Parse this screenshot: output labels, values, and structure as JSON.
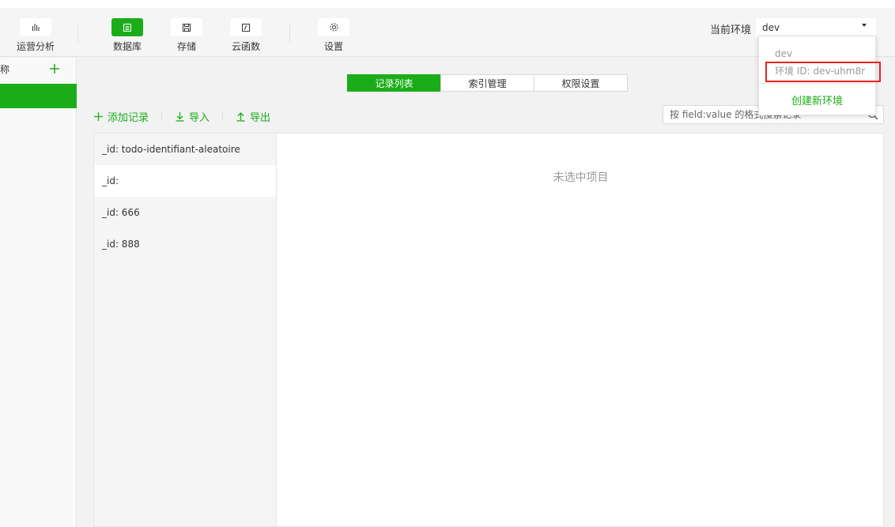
{
  "toolbar": {
    "items": [
      {
        "label": "运营分析",
        "icon": "bar-chart-icon"
      },
      {
        "label": "数据库",
        "icon": "database-icon",
        "active": true
      },
      {
        "label": "存储",
        "icon": "storage-icon"
      },
      {
        "label": "云函数",
        "icon": "cloud-function-icon"
      },
      {
        "label": "设置",
        "icon": "gear-icon"
      }
    ]
  },
  "environment": {
    "label": "当前环境",
    "selected": "dev",
    "dropdown": {
      "env_name": "dev",
      "env_id": "环境 ID: dev-uhm8r",
      "create_label": "创建新环境"
    }
  },
  "left_panel": {
    "header_fragment": "称"
  },
  "tabs": [
    {
      "label": "记录列表",
      "active": true
    },
    {
      "label": "索引管理"
    },
    {
      "label": "权限设置"
    }
  ],
  "actions": {
    "add_label": "添加记录",
    "import_label": "导入",
    "export_label": "导出"
  },
  "search": {
    "placeholder": "按 field:value 的格式搜索记录"
  },
  "records": [
    {
      "label": "_id: todo-identifiant-aleatoire"
    },
    {
      "label": "_id:"
    },
    {
      "label": "_id: 666"
    },
    {
      "label": "_id: 888"
    }
  ],
  "detail": {
    "empty_text": "未选中项目"
  },
  "colors": {
    "accent": "#1aad19",
    "highlight_border": "#e52222"
  }
}
